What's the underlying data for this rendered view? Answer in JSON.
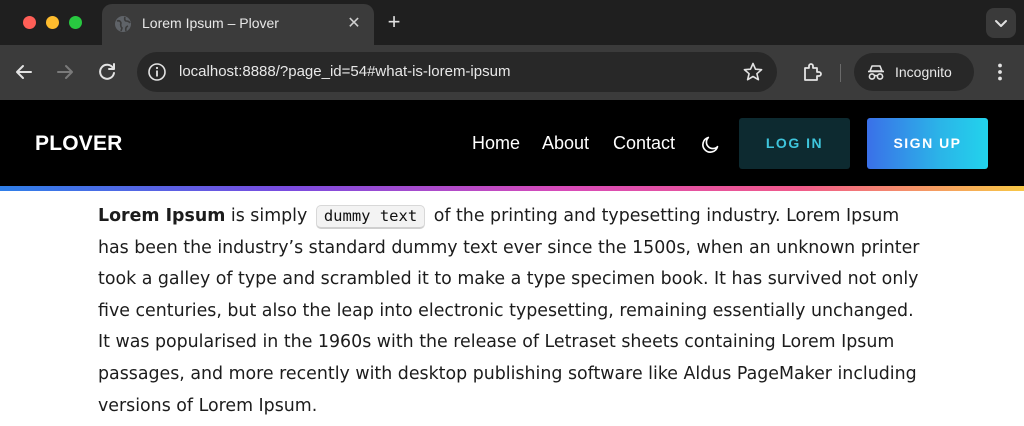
{
  "browser": {
    "tab_title": "Lorem Ipsum – Plover",
    "tab_close": "✕",
    "new_tab": "+",
    "url": "localhost:8888/?page_id=54#what-is-lorem-ipsum",
    "profile_label": "Incognito",
    "icons": [
      "globe-icon",
      "back-icon",
      "forward-icon",
      "reload-icon",
      "info-icon",
      "star-icon",
      "extensions-icon",
      "incognito-icon",
      "menu-icon",
      "chevron-down-icon"
    ]
  },
  "site": {
    "brand": "PLOVER",
    "nav": [
      "Home",
      "About",
      "Contact"
    ],
    "login_label": "LOG IN",
    "signup_label": "SIGN UP",
    "colors": {
      "header_bg": "#000000",
      "login_text": "#3ec5dc",
      "login_bg": "#0d2a30",
      "signup_gradient_start": "#3a70e8",
      "signup_gradient_end": "#22d3ec"
    }
  },
  "content": {
    "strong": "Lorem Ipsum",
    "before_code": " is simply ",
    "code": "dummy text",
    "after_code": " of the printing and typesetting industry. Lorem Ipsum has been the industry’s standard dummy text ever since the 1500s, when an unknown printer took a galley of type and scrambled it to make a type specimen book. It has survived not only five centuries, but also the leap into electronic typesetting, remaining essentially unchanged. It was popularised in the 1960s with the release of Letraset sheets containing Lorem Ipsum passages, and more recently with desktop publishing software like Aldus PageMaker including versions of Lorem Ipsum."
  }
}
